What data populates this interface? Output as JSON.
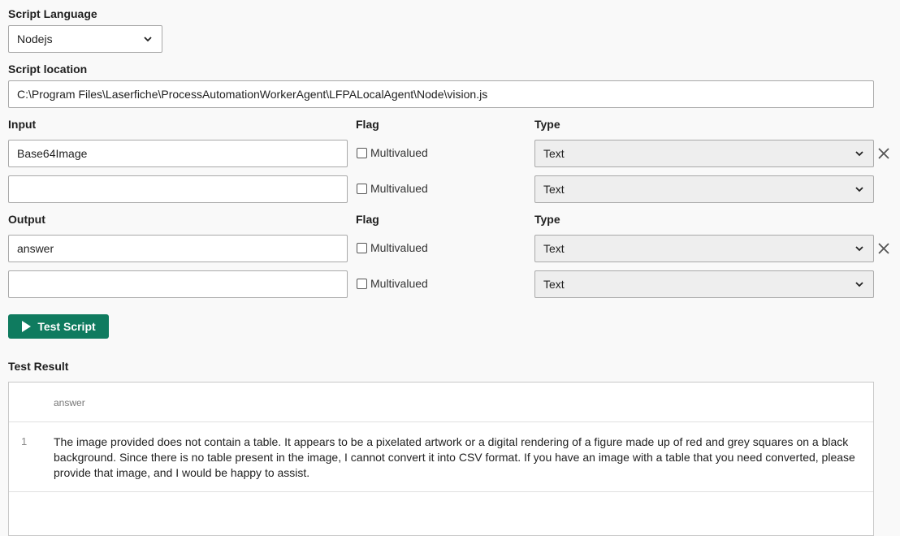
{
  "script_language": {
    "label": "Script Language",
    "selected": "Nodejs"
  },
  "script_location": {
    "label": "Script location",
    "value": "C:\\Program Files\\Laserfiche\\ProcessAutomationWorkerAgent\\LFPALocalAgent\\Node\\vision.js"
  },
  "input": {
    "headers": {
      "name": "Input",
      "flag": "Flag",
      "type": "Type"
    },
    "rows": [
      {
        "value": "Base64Image",
        "flag_label": "Multivalued",
        "type": "Text",
        "removable": true
      },
      {
        "value": "",
        "flag_label": "Multivalued",
        "type": "Text",
        "removable": false
      }
    ]
  },
  "output": {
    "headers": {
      "name": "Output",
      "flag": "Flag",
      "type": "Type"
    },
    "rows": [
      {
        "value": "answer",
        "flag_label": "Multivalued",
        "type": "Text",
        "removable": true
      },
      {
        "value": "",
        "flag_label": "Multivalued",
        "type": "Text",
        "removable": false
      }
    ]
  },
  "test_button": {
    "label": "Test Script"
  },
  "test_result": {
    "label": "Test Result",
    "column": "answer",
    "rows": [
      {
        "index": "1",
        "text": "The image provided does not contain a table. It appears to be a pixelated artwork or a digital rendering of a figure made up of red and grey squares on a black background. Since there is no table present in the image, I cannot convert it into CSV format. If you have an image with a table that you need converted, please provide that image, and I would be happy to assist."
      }
    ]
  },
  "colors": {
    "primary_button": "#0f7b5f",
    "background": "#f9f9f9"
  }
}
